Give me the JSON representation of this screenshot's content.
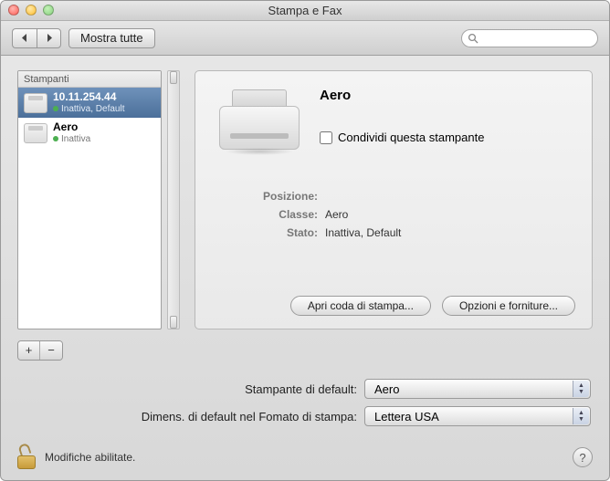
{
  "window": {
    "title": "Stampa e Fax"
  },
  "toolbar": {
    "show_all_label": "Mostra tutte",
    "search_placeholder": ""
  },
  "sidebar": {
    "header": "Stampanti",
    "items": [
      {
        "name": "10.11.254.44",
        "status": "Inattiva, Default",
        "selected": true
      },
      {
        "name": "Aero",
        "status": "Inattiva",
        "selected": false
      }
    ],
    "add_label": "+",
    "remove_label": "−"
  },
  "details": {
    "title": "Aero",
    "share_label": "Condividi questa stampante",
    "share_checked": false,
    "info": {
      "position_label": "Posizione:",
      "position_value": "",
      "class_label": "Classe:",
      "class_value": "Aero",
      "state_label": "Stato:",
      "state_value": "Inattiva, Default"
    },
    "buttons": {
      "open_queue": "Apri coda di stampa...",
      "options_supplies": "Opzioni e forniture..."
    }
  },
  "form": {
    "default_printer_label": "Stampante di default:",
    "default_printer_value": "Aero",
    "paper_size_label": "Dimens. di default nel Fomato di stampa:",
    "paper_size_value": "Lettera USA"
  },
  "footer": {
    "lock_text": "Modifiche abilitate.",
    "help_label": "?"
  }
}
